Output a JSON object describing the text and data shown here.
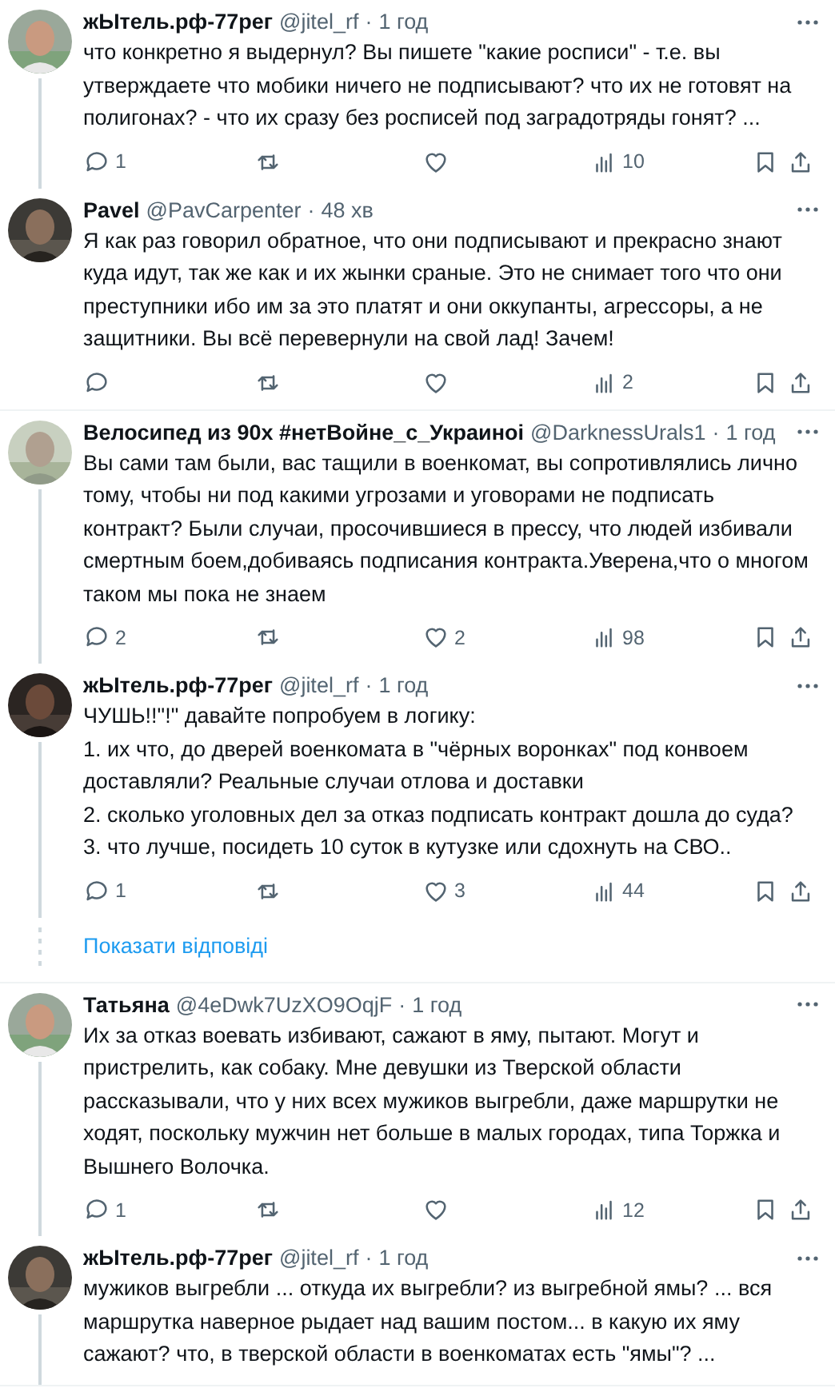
{
  "threads": [
    {
      "tweets": [
        {
          "name": "жЫтель.рф-77рег",
          "handle": "@jitel_rf",
          "separator": "·",
          "time": "1 год",
          "text": "что конкретно я выдернул? Вы пишете \"какие росписи\" - т.е. вы утверждаете что мобики ничего не подписывают? что их не готовят на полигонах? - что их сразу без росписей под заградотряды гонят? ...",
          "actions": {
            "replies": "1",
            "views": "10"
          },
          "thread_line": true
        },
        {
          "name": "Pavel",
          "handle": "@PavCarpenter",
          "separator": "·",
          "time": "48 хв",
          "text": "Я как раз говорил обратное, что они подписывают и прекрасно знают куда идут, так же как и их жынки сраные. Это не снимает того что они преступники ибо им за это платят и они оккупанты, агрессоры, а не защитники. Вы всё перевернули на свой лад! Зачем!",
          "actions": {
            "views": "2"
          },
          "thread_line": false
        }
      ]
    },
    {
      "tweets": [
        {
          "name": "Велосипед из 90х #нетВойне_с_Украиноі",
          "handle": "@DarknessUrals1",
          "separator": "·",
          "time": "1 год",
          "text": "Вы сами там были, вас тащили в военкомат, вы сопротивлялись лично тому, чтобы ни под какими угрозами и уговорами не подписать контракт? Были случаи, просочившиеся в прессу, что людей избивали смертным боем,добиваясь подписания контракта.Уверена,что о многом таком мы пока не знаем",
          "actions": {
            "replies": "2",
            "likes": "2",
            "views": "98"
          },
          "thread_line": true
        },
        {
          "name": "жЫтель.рф-77рег",
          "handle": "@jitel_rf",
          "separator": "·",
          "time": "1 год",
          "text": "ЧУШЬ!!\"!\" давайте попробуем в логику:\n1. их что, до дверей военкомата в \"чёрных воронках\" под конвоем доставляли? Реальные случаи отлова и доставки\n2. сколько уголовных дел за отказ подписать контракт дошла до суда?\n3. что лучше, посидеть 10 суток в кутузке или сдохнуть на СВО..",
          "actions": {
            "replies": "1",
            "likes": "3",
            "views": "44"
          },
          "thread_line": true
        }
      ],
      "show_replies": "Показати відповіді"
    },
    {
      "tweets": [
        {
          "name": "Татьяна",
          "handle": "@4eDwk7UzXO9OqjF",
          "separator": "·",
          "time": "1 год",
          "text": "Их за отказ воевать избивают, сажают в яму, пытают. Могут и пристрелить, как собаку. Мне девушки из Тверской области рассказывали, что у них всех мужиков выгребли, даже маршрутки не ходят, поскольку мужчин нет больше в малых городах, типа Торжка и Вышнего Волочка.",
          "actions": {
            "replies": "1",
            "views": "12"
          },
          "thread_line": true
        },
        {
          "name": "жЫтель.рф-77рег",
          "handle": "@jitel_rf",
          "separator": "·",
          "time": "1 год",
          "text": "мужиков выгребли ... откуда их выгребли? из выгребной ямы? ... вся маршрутка наверное рыдает над вашим постом... в какую их яму сажают? что, в тверской области в военкоматах есть \"ямы\"? ...",
          "thread_line": true
        }
      ]
    }
  ]
}
